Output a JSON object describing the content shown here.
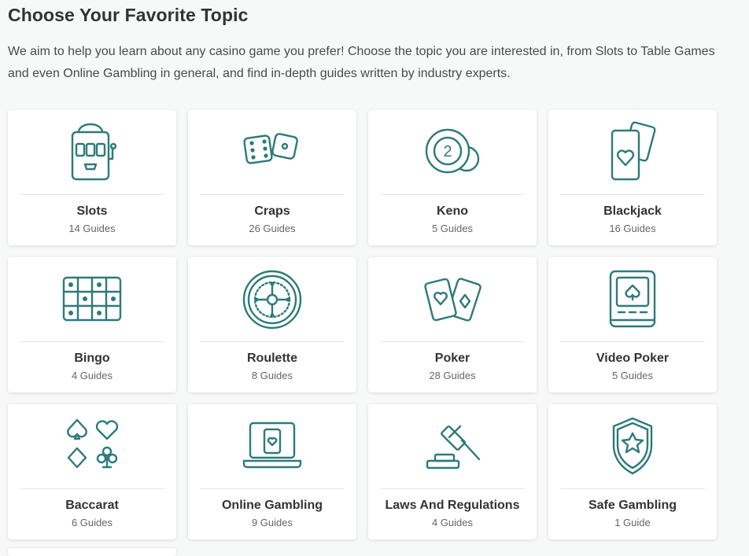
{
  "page": {
    "title": "Choose Your Favorite Topic",
    "intro": "We aim to help you learn about any casino game you prefer! Choose the topic you are interested in, from Slots to Table Games and even Online Gambling in general, and find in-depth guides written by industry experts."
  },
  "colors": {
    "accent": "#2e7a7b",
    "background": "#f7f8f8",
    "card": "#ffffff"
  },
  "topics": [
    {
      "name": "Slots",
      "count": "14 Guides",
      "icon": "slot-machine-icon"
    },
    {
      "name": "Craps",
      "count": "26 Guides",
      "icon": "dice-icon"
    },
    {
      "name": "Keno",
      "count": "5 Guides",
      "icon": "keno-balls-icon"
    },
    {
      "name": "Blackjack",
      "count": "16 Guides",
      "icon": "playing-cards-heart-icon"
    },
    {
      "name": "Bingo",
      "count": "4 Guides",
      "icon": "bingo-card-icon"
    },
    {
      "name": "Roulette",
      "count": "8 Guides",
      "icon": "roulette-wheel-icon"
    },
    {
      "name": "Poker",
      "count": "28 Guides",
      "icon": "poker-cards-icon"
    },
    {
      "name": "Video Poker",
      "count": "5 Guides",
      "icon": "video-poker-machine-icon"
    },
    {
      "name": "Baccarat",
      "count": "6 Guides",
      "icon": "card-suits-icon"
    },
    {
      "name": "Online Gambling",
      "count": "9 Guides",
      "icon": "laptop-card-icon"
    },
    {
      "name": "Laws And Regulations",
      "count": "4 Guides",
      "icon": "gavel-icon"
    },
    {
      "name": "Safe Gambling",
      "count": "1 Guide",
      "icon": "shield-star-icon"
    }
  ]
}
